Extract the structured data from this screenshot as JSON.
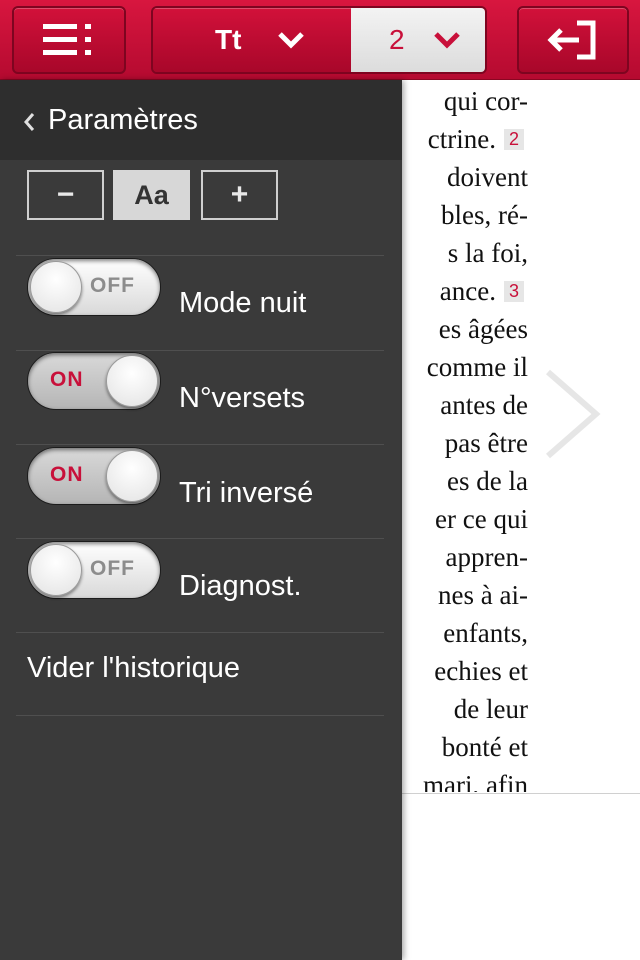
{
  "toolbar": {
    "menu_icon": "menu-icon",
    "font_style_label": "Tt",
    "chapter_value": "2",
    "exit_icon": "exit-icon"
  },
  "reader": {
    "lines": [
      "qui cor-",
      "ctrine.",
      "doivent",
      "bles, ré-",
      "s la foi,",
      "ance.",
      "es âgées",
      "comme il",
      "antes de",
      "pas être",
      "es de la",
      "er ce qui",
      "appren-",
      "nes à ai-",
      "enfants,",
      "echies et",
      "de leur",
      "bonté et",
      "mari, afin"
    ],
    "verse_badges": [
      "2",
      "3"
    ]
  },
  "settings": {
    "title": "Paramètres",
    "font_size": {
      "decrease": "−",
      "current": "Aa",
      "increase": "+"
    },
    "toggles": [
      {
        "label": "Mode nuit",
        "state": "OFF"
      },
      {
        "label": "N°versets",
        "state": "ON"
      },
      {
        "label": "Tri inversé",
        "state": "ON"
      },
      {
        "label": "Diagnost.",
        "state": "OFF"
      }
    ],
    "clear_history": "Vider l'historique"
  },
  "colors": {
    "brand": "#c8103a",
    "panel": "#3a3a3a"
  }
}
